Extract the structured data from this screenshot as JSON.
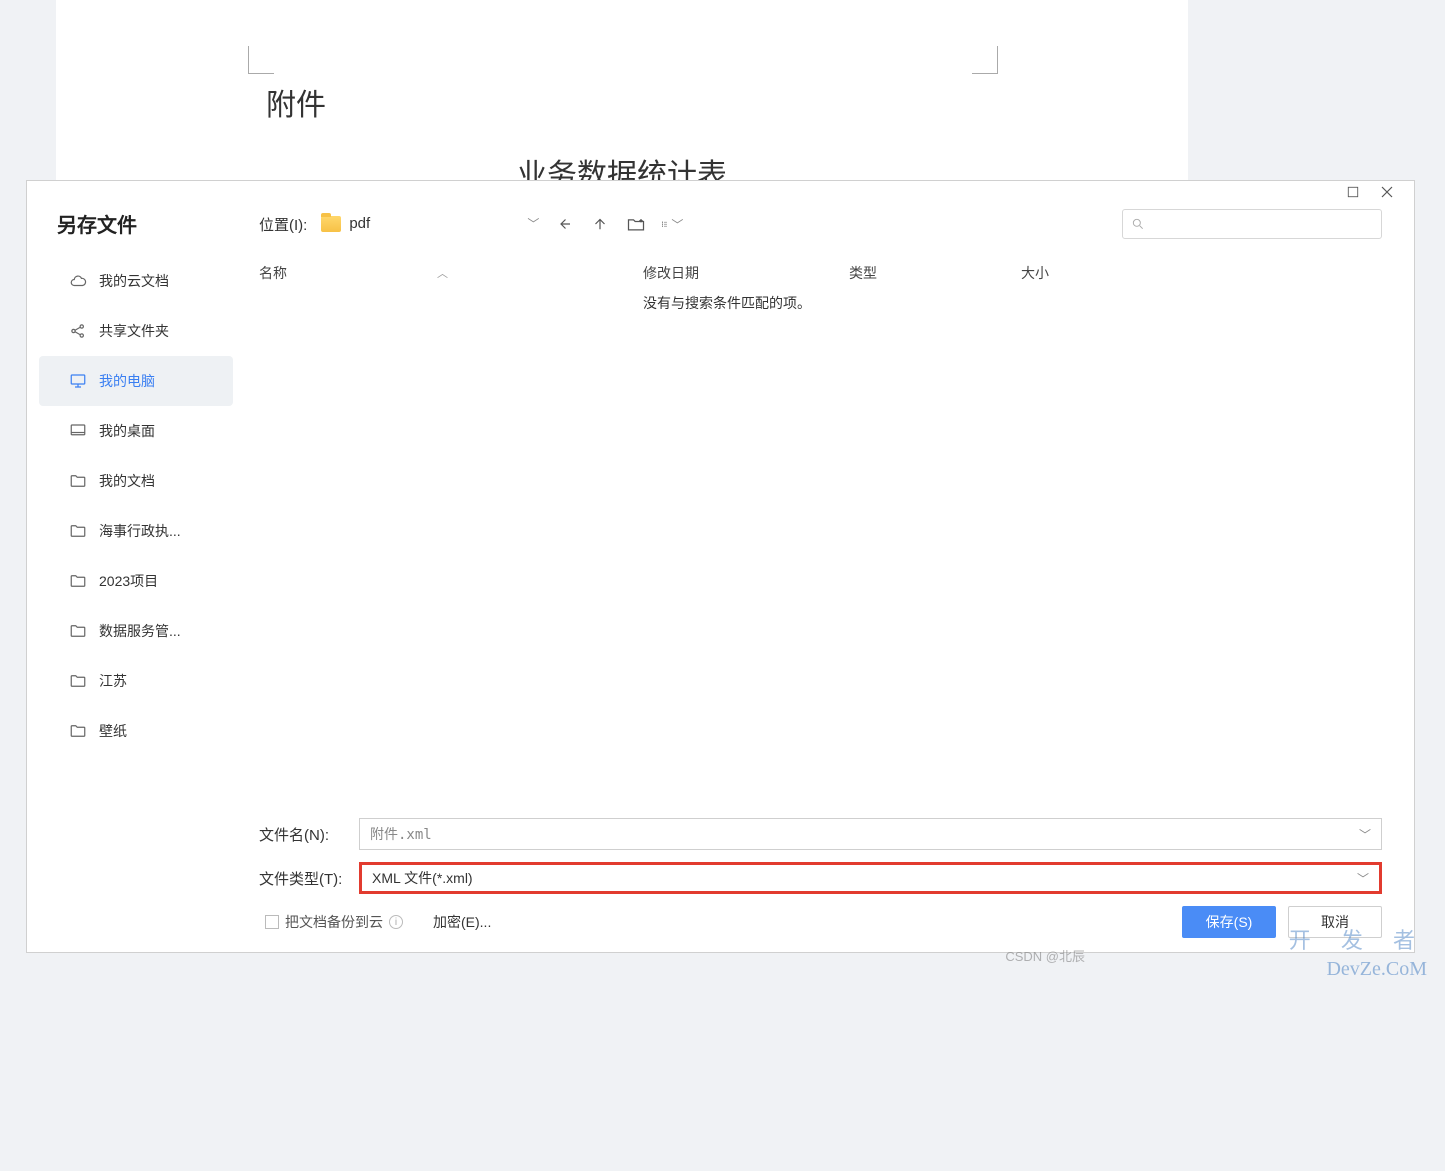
{
  "document": {
    "attachment_label": "附件",
    "title": "业务数据统计表"
  },
  "dialog": {
    "title": "另存文件",
    "sidebar": {
      "items": [
        {
          "icon": "cloud",
          "label": "我的云文档"
        },
        {
          "icon": "share",
          "label": "共享文件夹"
        },
        {
          "icon": "monitor",
          "label": "我的电脑"
        },
        {
          "icon": "desktop",
          "label": "我的桌面"
        },
        {
          "icon": "folder",
          "label": "我的文档"
        },
        {
          "icon": "folder",
          "label": "海事行政执..."
        },
        {
          "icon": "folder",
          "label": "2023项目"
        },
        {
          "icon": "folder",
          "label": "数据服务管..."
        },
        {
          "icon": "folder",
          "label": "江苏"
        },
        {
          "icon": "folder",
          "label": "壁纸"
        }
      ],
      "active_index": 2
    },
    "toolbar": {
      "location_label": "位置(I):",
      "location_value": "pdf",
      "search_placeholder": ""
    },
    "columns": {
      "name": "名称",
      "date": "修改日期",
      "type": "类型",
      "size": "大小"
    },
    "list": {
      "empty_message": "没有与搜索条件匹配的项。"
    },
    "footer": {
      "filename_label": "文件名(N):",
      "filename_value": "附件.xml",
      "filetype_label": "文件类型(T):",
      "filetype_value": "XML 文件(*.xml)",
      "backup_label": "把文档备份到云",
      "encrypt_label": "加密(E)...",
      "save_label": "保存(S)",
      "cancel_label": "取消"
    }
  },
  "watermarks": {
    "csdn": "CSDN @北辰",
    "cn": "开 发 者",
    "en": "DevZe.CoM"
  }
}
